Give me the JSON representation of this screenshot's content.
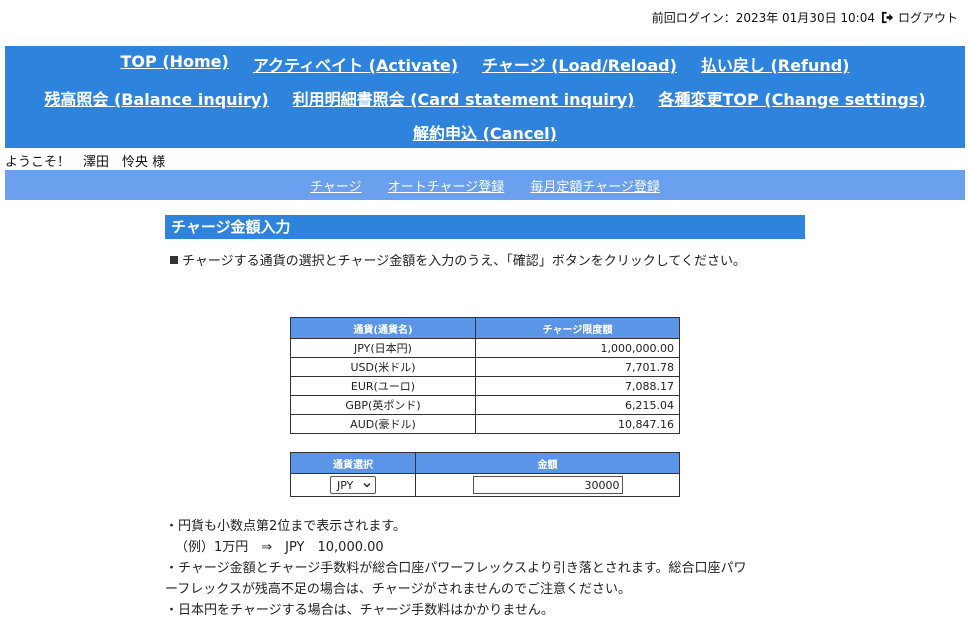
{
  "header": {
    "last_login": "前回ログイン：2023年 01月30日 10:04",
    "logout_label": "ログアウト"
  },
  "main_nav": {
    "row1": [
      {
        "label": "TOP (Home)"
      },
      {
        "label": "アクティベイト (Activate)"
      },
      {
        "label": "チャージ (Load/Reload)"
      },
      {
        "label": "払い戻し (Refund)"
      }
    ],
    "row2": [
      {
        "label": "残高照会 (Balance inquiry)"
      },
      {
        "label": "利用明細書照会 (Card statement inquiry)"
      },
      {
        "label": "各種変更TOP (Change settings)"
      }
    ],
    "row3": [
      {
        "label": "解約申込 (Cancel)"
      }
    ]
  },
  "welcome": "ようこそ！　澤田　怜央 様",
  "sub_nav": [
    {
      "label": "チャージ"
    },
    {
      "label": "オートチャージ登録"
    },
    {
      "label": "毎月定額チャージ登録"
    }
  ],
  "section_title": "チャージ金額入力",
  "instruction": "チャージする通貨の選択とチャージ金額を入力のうえ、「確認」ボタンをクリックしてください。",
  "limits_table": {
    "headers": [
      "通貨(通貨名)",
      "チャージ限度額"
    ],
    "rows": [
      {
        "currency": "JPY(日本円)",
        "limit": "1,000,000.00"
      },
      {
        "currency": "USD(米ドル)",
        "limit": "7,701.78"
      },
      {
        "currency": "EUR(ユーロ)",
        "limit": "7,088.17"
      },
      {
        "currency": "GBP(英ポンド)",
        "limit": "6,215.04"
      },
      {
        "currency": "AUD(豪ドル)",
        "limit": "10,847.16"
      }
    ]
  },
  "entry_table": {
    "headers": [
      "通貨選択",
      "金額"
    ],
    "selected_currency": "JPY",
    "amount": "30000"
  },
  "notes": [
    "・円貨も小数点第2位まで表示されます。",
    "（例）1万円　⇒　JPY　10,000.00",
    "・チャージ金額とチャージ手数料が総合口座パワーフレックスより引き落とされます。総合口座パワ",
    "ーフレックスが残高不足の場合は、チャージがされませんのでご注意ください。",
    "・日本円をチャージする場合は、チャージ手数料はかかりません。"
  ],
  "icons": {
    "logout": "logout-arrow-icon",
    "select": "chevron-down-icon"
  }
}
